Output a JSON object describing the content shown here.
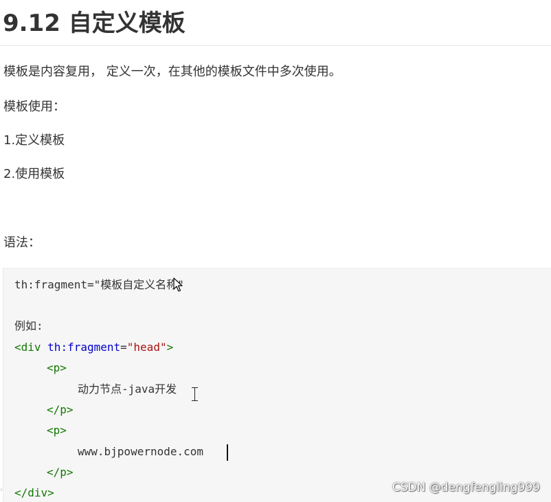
{
  "heading": "9.12 自定义模板",
  "paragraphs": {
    "intro": "模板是内容复用， 定义一次，在其他的模板文件中多次使用。",
    "usage_label": "模板使用：",
    "step1": "1.定义模板",
    "step2": "2.使用模板",
    "syntax_label": "语法："
  },
  "code": {
    "syntax_line": "th:fragment=\"模板自定义名称\"",
    "example_label": "例如:",
    "div_open_tag": "<div",
    "attr_name": "th:fragment",
    "equals": "=",
    "attr_value": "\"head\"",
    "div_open_close": ">",
    "p_open_1": "<p>",
    "text_1": "动力节点-java开发",
    "p_close_1": "</p>",
    "p_open_2": "<p>",
    "text_2": "www.bjpowernode.com",
    "p_close_2": "</p>",
    "div_close": "</div>"
  },
  "watermark": "CSDN @dengfengling999",
  "fold_icon": "chevron-right-icon"
}
